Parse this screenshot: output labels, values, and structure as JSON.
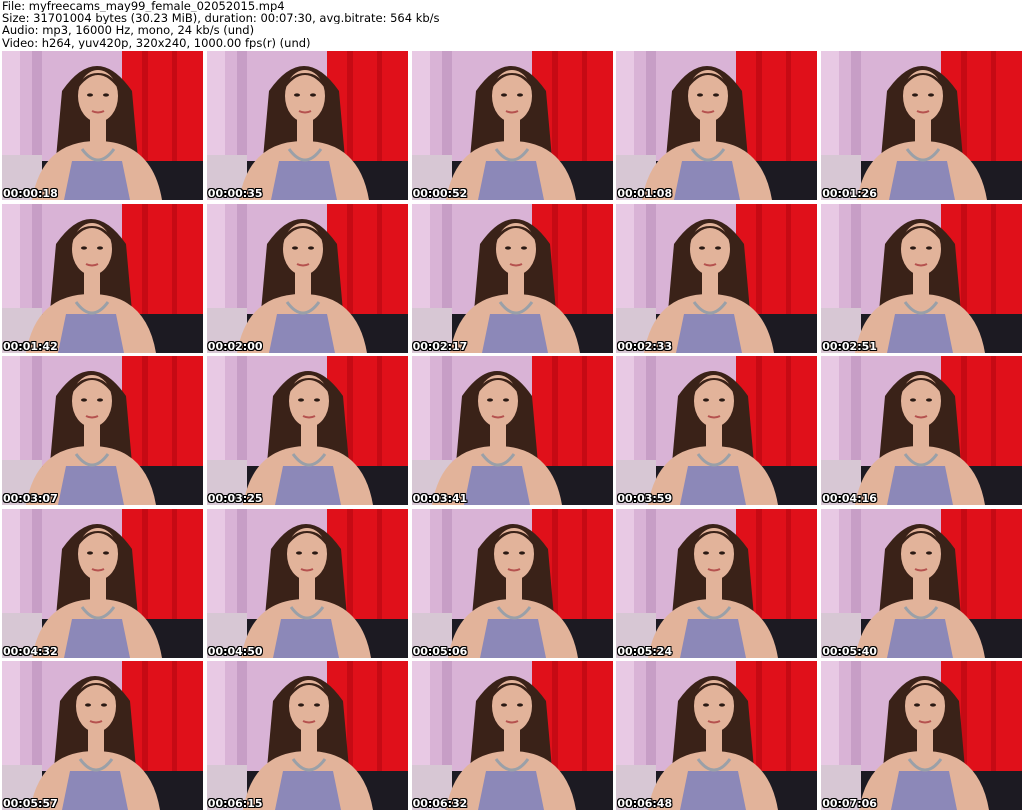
{
  "header": {
    "file_line": "File: myfreecams_may99_female_02052015.mp4",
    "size_line": "Size: 31701004 bytes (30.23 MiB), duration: 00:07:30, avg.bitrate: 564 kb/s",
    "audio_line": "Audio: mp3, 16000 Hz, mono, 24 kb/s (und)",
    "video_line": "Video: h264, yuv420p, 320x240, 1000.00 fps(r) (und)"
  },
  "colors": {
    "curtain_red": "#e0101a",
    "wall_pink": "#d9b3d6",
    "hair_brown": "#3a2218",
    "skin": "#e2b39a",
    "sofa_dark": "#1c1a22",
    "top_pattern": "#8c88b8"
  },
  "thumbnails": [
    {
      "timestamp": "00:00:18"
    },
    {
      "timestamp": "00:00:35"
    },
    {
      "timestamp": "00:00:52"
    },
    {
      "timestamp": "00:01:08"
    },
    {
      "timestamp": "00:01:26"
    },
    {
      "timestamp": "00:01:42"
    },
    {
      "timestamp": "00:02:00"
    },
    {
      "timestamp": "00:02:17"
    },
    {
      "timestamp": "00:02:33"
    },
    {
      "timestamp": "00:02:51"
    },
    {
      "timestamp": "00:03:07"
    },
    {
      "timestamp": "00:03:25"
    },
    {
      "timestamp": "00:03:41"
    },
    {
      "timestamp": "00:03:59"
    },
    {
      "timestamp": "00:04:16"
    },
    {
      "timestamp": "00:04:32"
    },
    {
      "timestamp": "00:04:50"
    },
    {
      "timestamp": "00:05:06"
    },
    {
      "timestamp": "00:05:24"
    },
    {
      "timestamp": "00:05:40"
    },
    {
      "timestamp": "00:05:57"
    },
    {
      "timestamp": "00:06:15"
    },
    {
      "timestamp": "00:06:32"
    },
    {
      "timestamp": "00:06:48"
    },
    {
      "timestamp": "00:07:06"
    }
  ]
}
